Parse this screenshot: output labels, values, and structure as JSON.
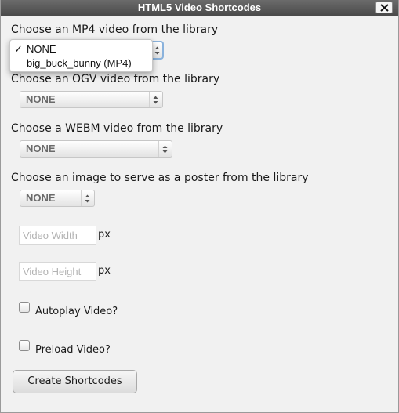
{
  "window": {
    "title": "HTML5 Video Shortcodes",
    "close_icon": "close-icon"
  },
  "mp4": {
    "label": "Choose an MP4 video from the library",
    "selected": "NONE",
    "options": [
      {
        "label": "NONE",
        "checked": true
      },
      {
        "label": "big_buck_bunny (MP4)",
        "checked": false
      }
    ],
    "checkmark": "✓"
  },
  "ogv": {
    "label": "Choose an OGV video from the library",
    "selected": "NONE"
  },
  "webm": {
    "label": "Choose a WEBM video from the library",
    "selected": "NONE"
  },
  "poster": {
    "label": "Choose an image to serve as a poster from the library",
    "selected": "NONE"
  },
  "width": {
    "placeholder": "Video Width",
    "value": "",
    "unit": "px"
  },
  "height": {
    "placeholder": "Video Height",
    "value": "",
    "unit": "px"
  },
  "autoplay": {
    "label": "Autoplay Video?",
    "checked": false
  },
  "preload": {
    "label": "Preload Video?",
    "checked": false
  },
  "submit": {
    "label": "Create Shortcodes"
  }
}
